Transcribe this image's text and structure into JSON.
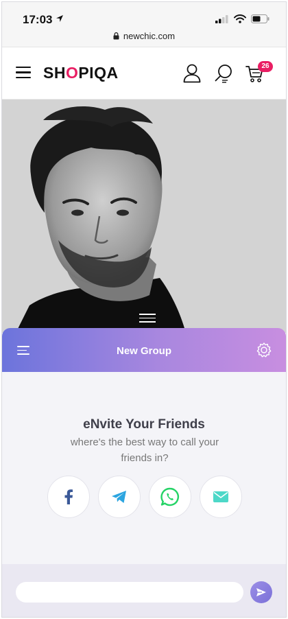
{
  "status_bar": {
    "time": "17:03",
    "url": "newchic.com"
  },
  "store": {
    "logo": "SHOPIQA",
    "cart_count": "26"
  },
  "icons": {
    "menu": "hamburger-icon",
    "account": "user-icon",
    "search": "search-icon",
    "cart": "cart-icon",
    "location": "location-arrow-icon",
    "lock": "lock-icon",
    "signal": "signal-icon",
    "wifi": "wifi-icon",
    "battery": "battery-icon",
    "panel_menu": "menu-lines-icon",
    "settings": "gear-icon",
    "send": "send-icon"
  },
  "chat_panel": {
    "title": "New Group",
    "invite_title": "eNvite Your Friends",
    "invite_subtitle": "where's the best way to call your friends in?",
    "share_options": [
      {
        "name": "facebook",
        "icon": "facebook-icon",
        "color": "#3b5998"
      },
      {
        "name": "telegram",
        "icon": "telegram-icon",
        "color": "#2ca5e0"
      },
      {
        "name": "whatsapp",
        "icon": "whatsapp-icon",
        "color": "#25d366"
      },
      {
        "name": "email",
        "icon": "mail-icon",
        "color": "#4dd8c8"
      }
    ],
    "message_input": {
      "value": "",
      "placeholder": ""
    }
  },
  "colors": {
    "accent_gradient_start": "#6c74dc",
    "accent_gradient_end": "#c88ee0",
    "badge": "#e91e63"
  }
}
